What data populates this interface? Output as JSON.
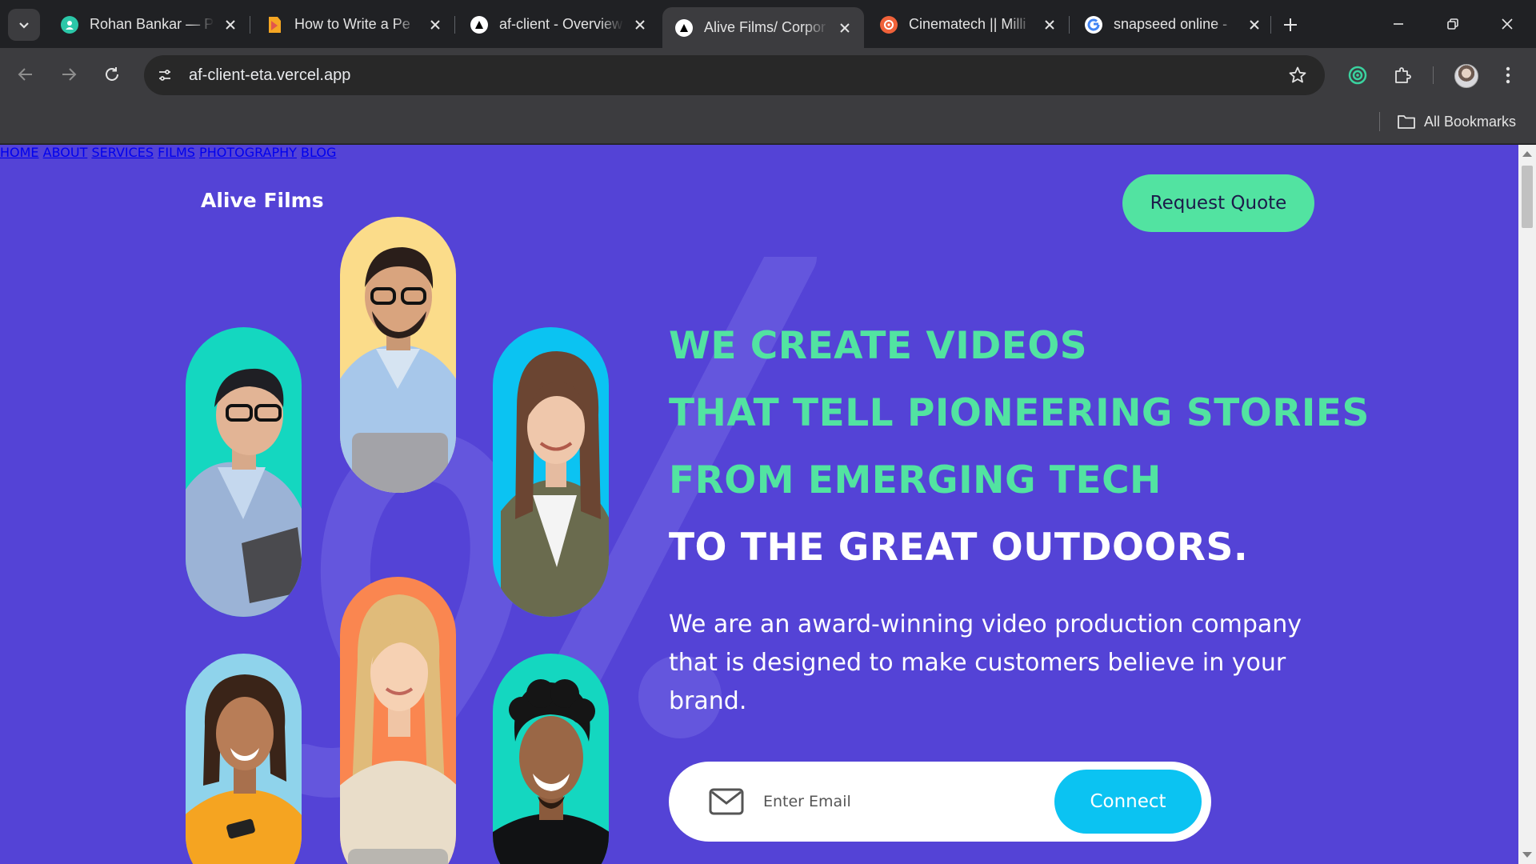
{
  "browser": {
    "tabs": [
      {
        "title": "Rohan Bankar — P",
        "favicon": "shield-person-icon",
        "active": false
      },
      {
        "title": "How to Write a Pe",
        "favicon": "document-icon",
        "active": false
      },
      {
        "title": "af-client - Overview",
        "favicon": "vercel-triangle-icon",
        "active": false
      },
      {
        "title": "Alive Films/ Corpor",
        "favicon": "vercel-triangle-icon",
        "active": true
      },
      {
        "title": "Cinematech || Milli",
        "favicon": "film-icon",
        "active": false
      },
      {
        "title": "snapseed online - ",
        "favicon": "google-icon",
        "active": false
      }
    ],
    "url": "af-client-eta.vercel.app",
    "bookmarks_label": "All Bookmarks"
  },
  "site": {
    "brand": "Alive Films",
    "nav": [
      "HOME",
      "ABOUT",
      "SERVICES",
      "FILMS",
      "PHOTOGRAPHY",
      "BLOG"
    ],
    "cta": "Request Quote",
    "hero": {
      "lines": [
        "WE CREATE VIDEOS",
        "THAT TELL PIONEERING STORIES",
        "FROM EMERGING TECH",
        "TO THE GREAT OUTDOORS."
      ],
      "description": "We are an award-winning video production company that is designed to make customers believe in your brand."
    },
    "form": {
      "placeholder": "Enter Email",
      "button": "Connect"
    }
  },
  "colors": {
    "page_bg": "#5443d6",
    "accent_green": "#52e3a1",
    "accent_cyan": "#0bc3f2"
  }
}
